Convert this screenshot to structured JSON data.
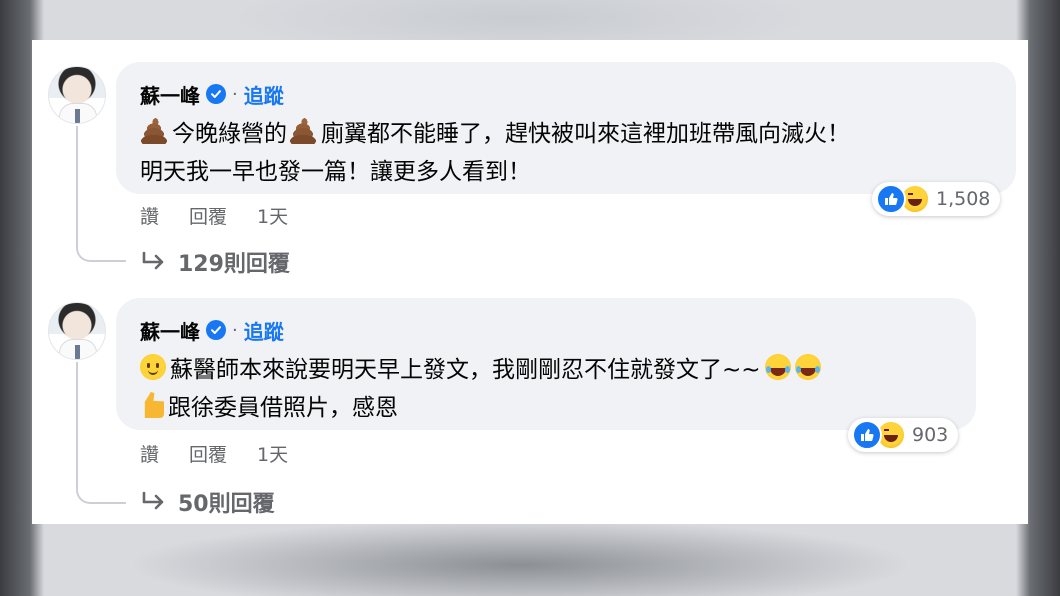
{
  "colors": {
    "accent": "#1877f2",
    "bubble": "#f0f2f5",
    "text": "#050505",
    "muted": "#65676b"
  },
  "comments": [
    {
      "author": "蘇一峰",
      "verified": true,
      "separator": "·",
      "follow_label": "追蹤",
      "lines": [
        {
          "icon": "poo-emoji",
          "text_a": "今晚綠營的",
          "icon_mid": "poo-emoji",
          "text_b": "廁翼都不能睡了，趕快被叫來這裡加班帶風向滅火！"
        },
        {
          "text": "明天我一早也發一篇！讓更多人看到！"
        }
      ],
      "actions": {
        "like": "讚",
        "reply": "回覆",
        "time": "1天"
      },
      "reactions": {
        "types": [
          "like-icon",
          "haha-icon"
        ],
        "count": "1,508"
      },
      "replies_label": "129則回覆"
    },
    {
      "author": "蘇一峰",
      "verified": true,
      "separator": "·",
      "follow_label": "追蹤",
      "lines": [
        {
          "icon": "smile-emoji",
          "text": "蘇醫師本來說要明天早上發文，我剛剛忍不住就發文了~~",
          "trailing": [
            "laugh-cry-emoji",
            "laugh-cry-emoji"
          ]
        },
        {
          "icon": "thumbs-up-emoji",
          "text": "跟徐委員借照片，感恩"
        }
      ],
      "actions": {
        "like": "讚",
        "reply": "回覆",
        "time": "1天"
      },
      "reactions": {
        "types": [
          "like-icon",
          "haha-icon"
        ],
        "count": "903"
      },
      "replies_label": "50則回覆"
    }
  ]
}
